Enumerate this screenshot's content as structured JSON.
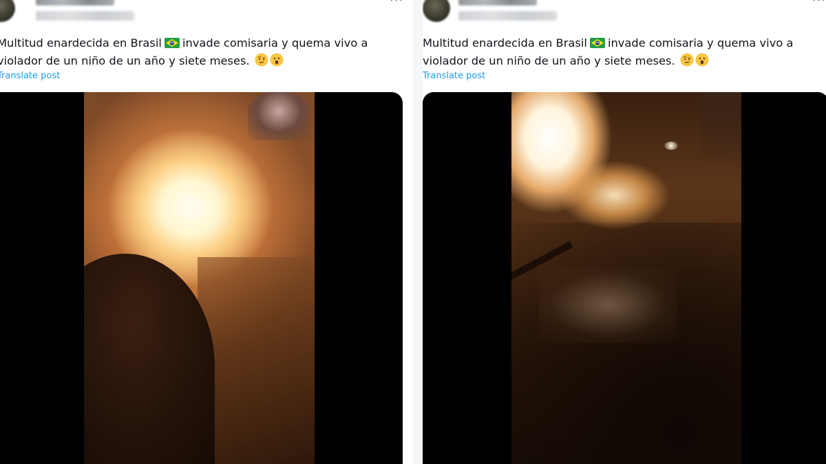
{
  "posts": [
    {
      "text_line1_before_flag": "Multitud enardecida en Brasil",
      "text_line1_after_flag": "invade comisaria y quema vivo a",
      "text_line2": "violador de un niño de un año y siete meses.",
      "translate_label": "Translate post",
      "more_label": "···",
      "media_alt": "Video frame: fire at night"
    },
    {
      "text_line1_before_flag": "Multitud enardecida en Brasil",
      "text_line1_after_flag": "invade comisaria y quema vivo a",
      "text_line2": "violador de un niño de un año y siete meses.",
      "translate_label": "Translate post",
      "more_label": "···",
      "media_alt": "Video frame: burning debris on the ground"
    }
  ],
  "icons": {
    "flag": "brazil-flag-icon",
    "emoji_1": "face-with-raised-eyebrow-icon",
    "emoji_2": "face-with-open-mouth-icon",
    "more": "more-options-icon"
  },
  "colors": {
    "link": "#1d9bf0",
    "text": "#0f1419",
    "media_background": "#000000"
  }
}
